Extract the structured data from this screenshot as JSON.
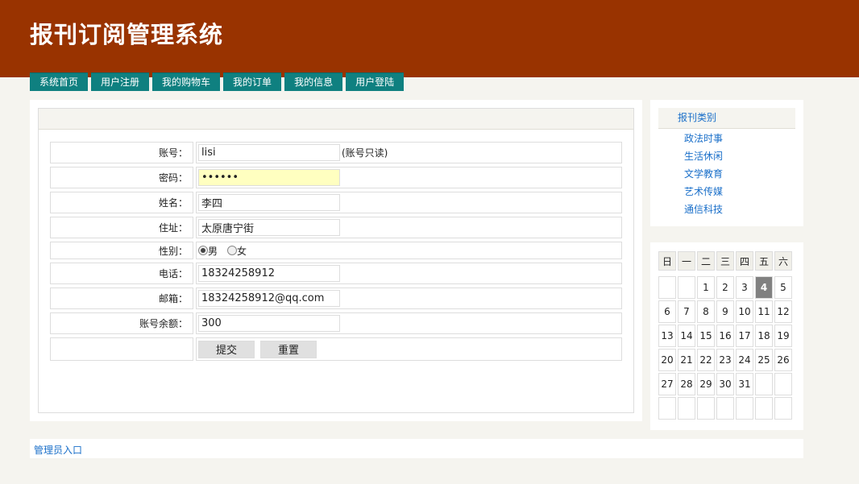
{
  "header": {
    "title": "报刊订阅管理系统",
    "bg_color": "#993300"
  },
  "nav": {
    "items": [
      {
        "label": "系统首页"
      },
      {
        "label": "用户注册"
      },
      {
        "label": "我的购物车"
      },
      {
        "label": "我的订单"
      },
      {
        "label": "我的信息"
      },
      {
        "label": "用户登陆"
      }
    ],
    "bg_color": "#0f8080"
  },
  "form": {
    "account": {
      "label": "账号：",
      "value": "lisi",
      "note": "(账号只读)"
    },
    "password": {
      "label": "密码：",
      "value": "••••••"
    },
    "name": {
      "label": "姓名：",
      "value": "李四"
    },
    "address": {
      "label": "住址：",
      "value": "太原唐宁街"
    },
    "gender": {
      "label": "性别：",
      "options": [
        "男",
        "女"
      ],
      "selected": "男"
    },
    "phone": {
      "label": "电话：",
      "value": "18324258912"
    },
    "email": {
      "label": "邮箱：",
      "value": "18324258912@qq.com"
    },
    "balance": {
      "label": "账号余额：",
      "value": "300"
    },
    "submit_label": "提交",
    "reset_label": "重置"
  },
  "sidebar": {
    "category_title": "报刊类别",
    "categories": [
      "政法时事",
      "生活休闲",
      "文学教育",
      "艺术传媒",
      "通信科技"
    ]
  },
  "calendar": {
    "weekdays": [
      "日",
      "一",
      "二",
      "三",
      "四",
      "五",
      "六"
    ],
    "weeks": [
      [
        "",
        "",
        "1",
        "2",
        "3",
        "4",
        "5"
      ],
      [
        "6",
        "7",
        "8",
        "9",
        "10",
        "11",
        "12"
      ],
      [
        "13",
        "14",
        "15",
        "16",
        "17",
        "18",
        "19"
      ],
      [
        "20",
        "21",
        "22",
        "23",
        "24",
        "25",
        "26"
      ],
      [
        "27",
        "28",
        "29",
        "30",
        "31",
        "",
        ""
      ],
      [
        "",
        "",
        "",
        "",
        "",
        "",
        ""
      ]
    ],
    "today": "4"
  },
  "footer": {
    "admin_link": "管理员入口"
  }
}
